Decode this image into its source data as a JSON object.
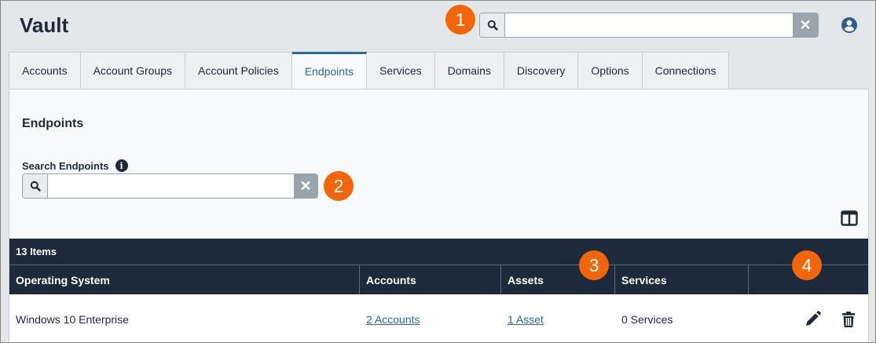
{
  "header": {
    "app_title": "Vault",
    "search": {
      "value": "",
      "placeholder": ""
    },
    "icons": {
      "search": "search-icon",
      "clear": "close-icon",
      "user": "user-circle-icon"
    }
  },
  "tabs": [
    {
      "label": "Accounts",
      "active": false
    },
    {
      "label": "Account Groups",
      "active": false
    },
    {
      "label": "Account Policies",
      "active": false
    },
    {
      "label": "Endpoints",
      "active": true
    },
    {
      "label": "Services",
      "active": false
    },
    {
      "label": "Domains",
      "active": false
    },
    {
      "label": "Discovery",
      "active": false
    },
    {
      "label": "Options",
      "active": false
    },
    {
      "label": "Connections",
      "active": false
    }
  ],
  "panel": {
    "title": "Endpoints",
    "search_label": "Search Endpoints",
    "search": {
      "value": "",
      "placeholder": ""
    }
  },
  "table": {
    "count_label": "13 Items",
    "columns": [
      "Operating System",
      "Accounts",
      "Assets",
      "Services",
      ""
    ],
    "rows": [
      {
        "os": "Windows 10 Enterprise",
        "accounts": "2 Accounts",
        "assets": "1 Asset",
        "services": "0 Services"
      }
    ]
  },
  "callouts": [
    "1",
    "2",
    "3",
    "4"
  ],
  "colors": {
    "accent": "#2a6b9d",
    "callout": "#f2650b",
    "table_header": "#1c2a3b"
  }
}
